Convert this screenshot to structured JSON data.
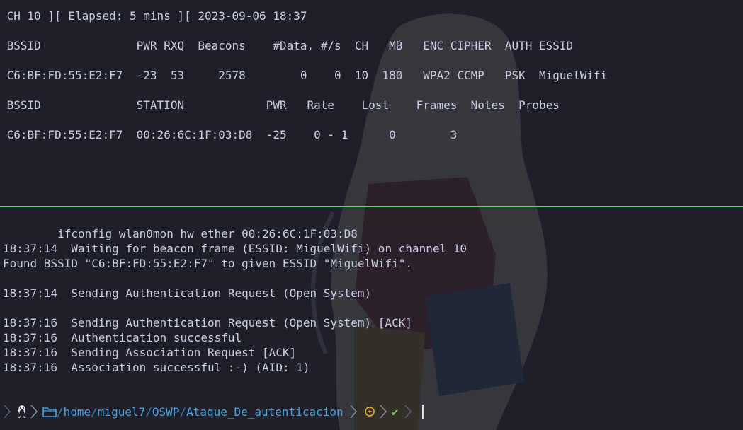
{
  "top_pane": {
    "lines": [
      " CH 10 ][ Elapsed: 5 mins ][ 2023-09-06 18:37",
      "",
      " BSSID              PWR RXQ  Beacons    #Data, #/s  CH   MB   ENC CIPHER  AUTH ESSID",
      "",
      " C6:BF:FD:55:E2:F7  -23  53     2578        0    0  10  180   WPA2 CCMP   PSK  MiguelWifi",
      "",
      " BSSID              STATION            PWR   Rate    Lost    Frames  Notes  Probes",
      "",
      " C6:BF:FD:55:E2:F7  00:26:6C:1F:03:D8  -25    0 - 1      0        3"
    ]
  },
  "bottom_pane": {
    "lines": [
      "        ifconfig wlan0mon hw ether 00:26:6C:1F:03:D8",
      "18:37:14  Waiting for beacon frame (ESSID: MiguelWifi) on channel 10",
      "Found BSSID \"C6:BF:FD:55:E2:F7\" to given ESSID \"MiguelWifi\".",
      "",
      "18:37:14  Sending Authentication Request (Open System)",
      "",
      "18:37:16  Sending Authentication Request (Open System) [ACK]",
      "18:37:16  Authentication successful",
      "18:37:16  Sending Association Request [ACK]",
      "18:37:16  Association successful :-) (AID: 1)"
    ]
  },
  "prompt": {
    "path_parts": [
      "home",
      "miguel7",
      "OSWP",
      "Ataque_De_autenticacion"
    ],
    "check": "✔",
    "colors": {
      "path": "#4aa3e0",
      "check": "#7ec850",
      "divider": "#5fd17a",
      "background": "#1e1f29"
    }
  }
}
